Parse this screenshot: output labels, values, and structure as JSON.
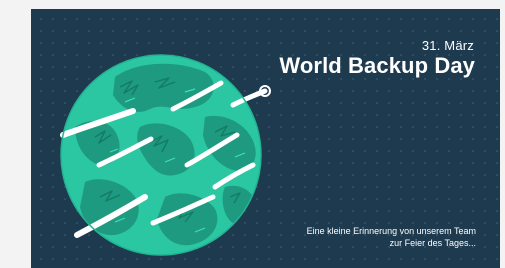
{
  "banner": {
    "date": "31. März",
    "title": "World Backup Day",
    "subtitle_line1": "Eine kleine Erinnerung von unserem Team",
    "subtitle_line2": "zur Feier des Tages..."
  },
  "illustration": {
    "icon": "globe-icon",
    "colors": {
      "background": "#1e3a4f",
      "ocean": "#2bc7a2",
      "land": "#1d9a7f",
      "streaks": "#ffffff"
    }
  }
}
